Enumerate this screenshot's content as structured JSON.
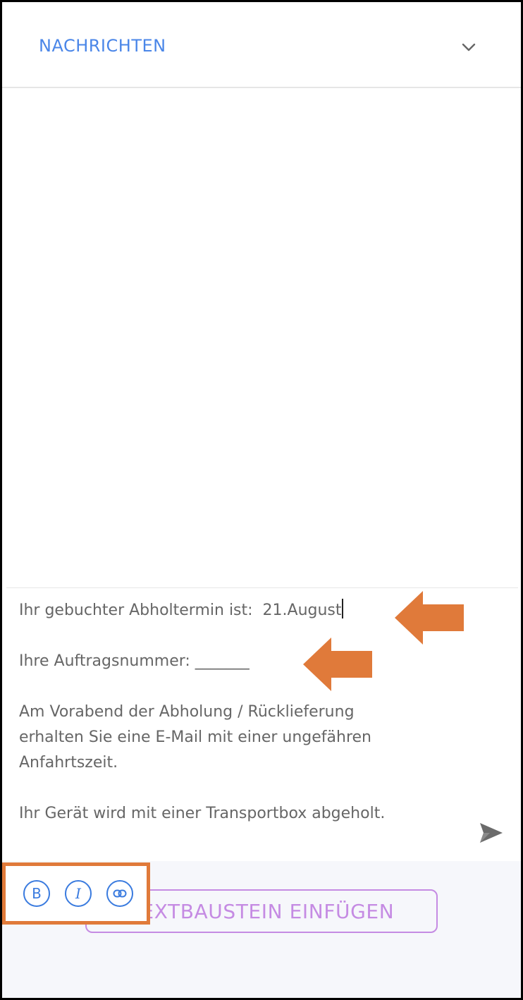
{
  "header": {
    "title": "NACHRICHTEN",
    "collapse_icon": "chevron-down-icon"
  },
  "editor": {
    "lines": [
      "Ihr gebuchter Abholtermin ist:  21.August",
      "Ihre Auftragsnummer: _______",
      "Am Vorabend der Abholung / Rücklieferung\nerhalten Sie eine E-Mail mit einer ungefähren\nAnfahrtszeit.",
      "Ihr Gerät wird mit einer Transportbox abgeholt."
    ],
    "send_icon": "send-icon"
  },
  "toolbar": {
    "bold_label": "B",
    "italic_label": "I",
    "link_icon": "link-icon",
    "textbaustein_label": "TEXTBAUSTEIN EINFÜGEN"
  },
  "colors": {
    "accent": "#4a86e8",
    "annotation": "#e07a3a",
    "textbaustein": "#c58be3"
  }
}
